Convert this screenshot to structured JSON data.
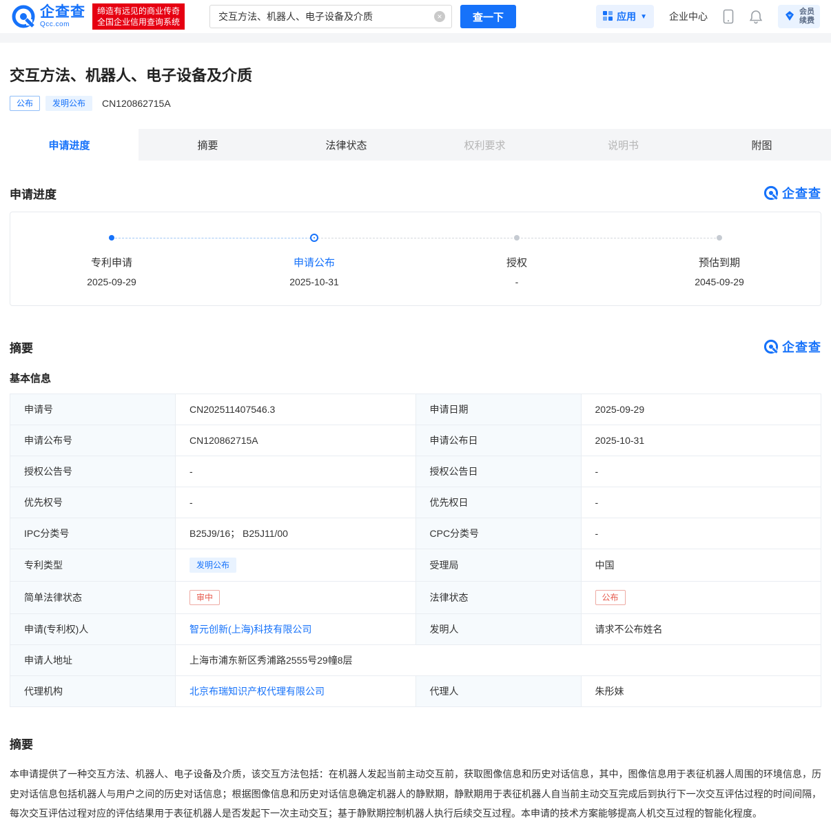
{
  "brand": {
    "name": "企查查",
    "domain": "Qcc.com",
    "slogan1": "缔造有远见的商业传奇",
    "slogan2": "全国企业信用查询系统",
    "primary_color": "#1672fa",
    "slogan_bg_color": "#e60012"
  },
  "header": {
    "search_value": "交互方法、机器人、电子设备及介质",
    "search_button": "查一下",
    "apps_label": "应用",
    "enterprise_center": "企业中心",
    "vip_line1": "会员",
    "vip_line2": "续费",
    "icons": [
      "apps-grid-icon",
      "mobile-icon",
      "bell-icon",
      "vip-icon"
    ]
  },
  "patent": {
    "title": "交互方法、机器人、电子设备及介质",
    "tag_publish": "公布",
    "tag_type": "发明公布",
    "number": "CN120862715A"
  },
  "tabs": [
    {
      "label": "申请进度",
      "state": "active"
    },
    {
      "label": "摘要",
      "state": "normal"
    },
    {
      "label": "法律状态",
      "state": "normal"
    },
    {
      "label": "权利要求",
      "state": "disabled"
    },
    {
      "label": "说明书",
      "state": "disabled"
    },
    {
      "label": "附图",
      "state": "normal"
    }
  ],
  "progress": {
    "title": "申请进度",
    "steps": [
      {
        "label": "专利申请",
        "date": "2025-09-29",
        "state": "done"
      },
      {
        "label": "申请公布",
        "date": "2025-10-31",
        "state": "current"
      },
      {
        "label": "授权",
        "date": "-",
        "state": "pending"
      },
      {
        "label": "预估到期",
        "date": "2045-09-29",
        "state": "pending"
      }
    ]
  },
  "summary": {
    "title": "摘要",
    "basic_title": "基本信息",
    "rows": [
      {
        "l1": "申请号",
        "v1": "CN202511407546.3",
        "l2": "申请日期",
        "v2": "2025-09-29"
      },
      {
        "l1": "申请公布号",
        "v1": "CN120862715A",
        "l2": "申请公布日",
        "v2": "2025-10-31"
      },
      {
        "l1": "授权公告号",
        "v1": "-",
        "l2": "授权公告日",
        "v2": "-"
      },
      {
        "l1": "优先权号",
        "v1": "-",
        "l2": "优先权日",
        "v2": "-"
      },
      {
        "l1": "IPC分类号",
        "v1": "B25J9/16； B25J11/00",
        "l2": "CPC分类号",
        "v2": "-"
      },
      {
        "l1": "专利类型",
        "v1": "发明公布",
        "l2": "受理局",
        "v2": "中国"
      },
      {
        "l1": "简单法律状态",
        "v1": "审中",
        "l2": "法律状态",
        "v2": "公布"
      },
      {
        "l1": "申请(专利权)人",
        "v1": "智元创新(上海)科技有限公司",
        "l2": "发明人",
        "v2": "请求不公布姓名"
      },
      {
        "l1": "申请人地址",
        "v1": "上海市浦东新区秀浦路2555号29幢8层"
      },
      {
        "l1": "代理机构",
        "v1": "北京布瑞知识产权代理有限公司",
        "l2": "代理人",
        "v2": "朱彤妹"
      }
    ]
  },
  "abstract": {
    "title": "摘要",
    "text": "本申请提供了一种交互方法、机器人、电子设备及介质，该交互方法包括：在机器人发起当前主动交互前，获取图像信息和历史对话信息，其中，图像信息用于表征机器人周围的环境信息，历史对话信息包括机器人与用户之间的历史对话信息；根据图像信息和历史对话信息确定机器人的静默期，静默期用于表征机器人自当前主动交互完成后到执行下一次交互评估过程的时间间隔，每次交互评估过程对应的评估结果用于表征机器人是否发起下一次主动交互；基于静默期控制机器人执行后续交互过程。本申请的技术方案能够提高人机交互过程的智能化程度。"
  }
}
